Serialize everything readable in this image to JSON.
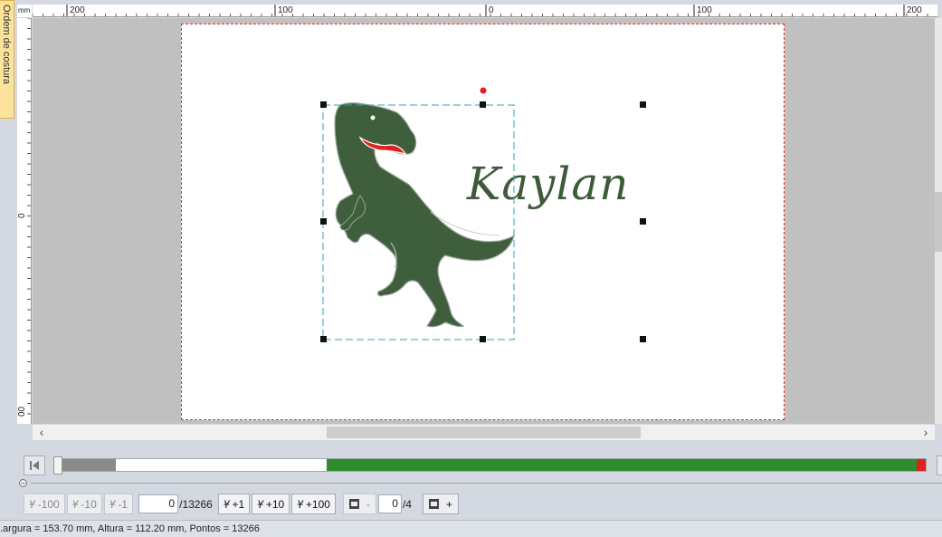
{
  "side_tab": {
    "label": "Ordem de costura"
  },
  "ruler": {
    "unit": "mm",
    "top_labels": [
      "200",
      "100",
      "0",
      "100",
      "200"
    ],
    "left_labels": [
      "0",
      "00"
    ]
  },
  "design": {
    "text": "Kaylan",
    "text_color": "#3d5a3a",
    "dino_color": "#3f5f3c",
    "mouth_color": "#e02020",
    "selection_color": "#2aa8b0",
    "rotate_handle_color": "#e02020"
  },
  "progress": {
    "stitch_fraction": 0.0,
    "colors": {
      "done": "#2e8b2e",
      "start": "#8a8a8a",
      "end": "#e02020"
    }
  },
  "toolbar": {
    "minus100": "-100",
    "minus10": "-10",
    "minus1": "-1",
    "stitch_current": "0",
    "stitch_total": "/13266",
    "plus1": "+1",
    "plus10": "+10",
    "plus100": "+100",
    "color_minus": "-",
    "color_current": "0",
    "color_total": "/4",
    "color_plus": "+"
  },
  "status": {
    "text": ".argura = 153.70 mm, Altura = 112.20 mm, Pontos = 13266"
  }
}
